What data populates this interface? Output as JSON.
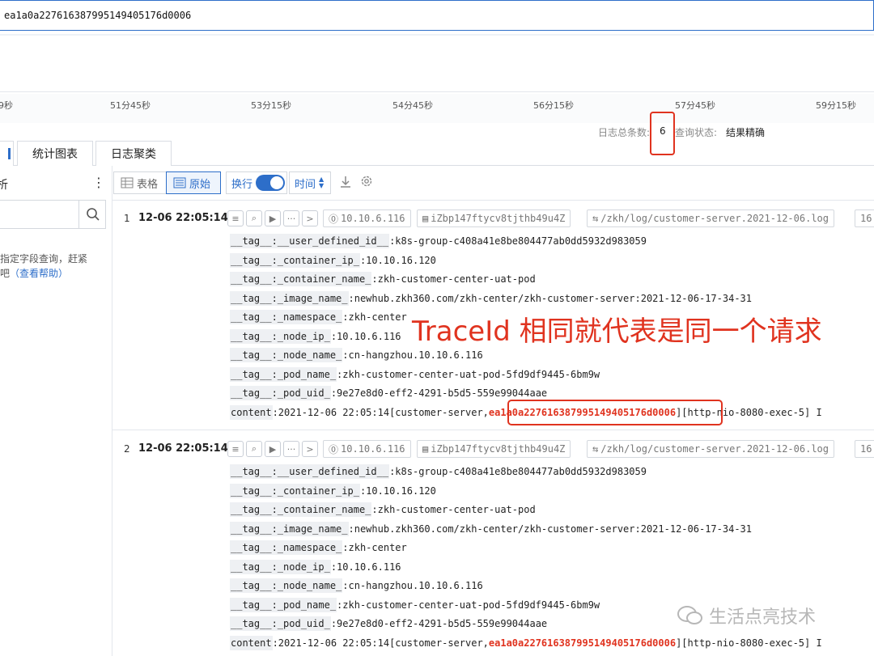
{
  "search": {
    "value": "ea1a0a22761638799514940517­6d0006"
  },
  "timeline": {
    "ticks": [
      "9秒",
      "51分45秒",
      "53分15秒",
      "54分45秒",
      "56分15秒",
      "57分45秒",
      "59分15秒"
    ]
  },
  "summary": {
    "total_label": "日志总条数:",
    "total_value": "6",
    "status_label": "查询状态:",
    "status_value": "结果精确"
  },
  "tabs": {
    "first": " ",
    "stats": "统计图表",
    "cluster": "日志聚类"
  },
  "sidebar": {
    "header": "析",
    "more": "⋮",
    "tip_line1": "指定字段查询，赶紧",
    "tip_line2_prefix": "吧",
    "tip_link": "（查看帮助）"
  },
  "toolbar": {
    "table_label": "表格",
    "raw_label": "原始",
    "wrap_label": "换行",
    "time_label": "时间"
  },
  "records": [
    {
      "index": "1",
      "time": "12-06 22:05:14",
      "ip": "10.10.6.116",
      "host": "iZbp147ftycv8tjthb49u4Z",
      "path": "/zkh/log/customer-server.2021-12-06.log",
      "extra": "16",
      "fields": [
        {
          "key": "__tag__:__user_defined_id__",
          "value": ":k8s-group-c408a41e8be804477ab0dd5932d983059"
        },
        {
          "key": "__tag__:_container_ip_",
          "value": ":10.10.16.120"
        },
        {
          "key": "__tag__:_container_name_",
          "value": ":zkh-customer-center-uat-pod"
        },
        {
          "key": "__tag__:_image_name_",
          "value": ":newhub.zkh360.com/zkh-center/zkh-customer-server:2021-12-06-17-34-31"
        },
        {
          "key": "__tag__:_namespace_",
          "value": ":zkh-center"
        },
        {
          "key": "__tag__:_node_ip_",
          "value": ":10.10.6.116"
        },
        {
          "key": "__tag__:_node_name_",
          "value": ":cn-hangzhou.10.10.6.116"
        },
        {
          "key": "__tag__:_pod_name_",
          "value": ":zkh-customer-center-uat-pod-5fd9df9445-6bm9w"
        },
        {
          "key": "__tag__:_pod_uid_",
          "value": ":9e27e8d0-eff2-4291-b5d5-559e99044aae"
        }
      ],
      "content_key": "content",
      "content_prefix": ":2021-12-06 22:05:14[customer-server, ",
      "content_trace": "ea1a0a22761638799514940517­6d0006",
      "content_suffix": " ][http-nio-8080-exec-5] I"
    },
    {
      "index": "2",
      "time": "12-06 22:05:14",
      "ip": "10.10.6.116",
      "host": "iZbp147ftycv8tjthb49u4Z",
      "path": "/zkh/log/customer-server.2021-12-06.log",
      "extra": "16",
      "fields": [
        {
          "key": "__tag__:__user_defined_id__",
          "value": ":k8s-group-c408a41e8be804477ab0dd5932d983059"
        },
        {
          "key": "__tag__:_container_ip_",
          "value": ":10.10.16.120"
        },
        {
          "key": "__tag__:_container_name_",
          "value": ":zkh-customer-center-uat-pod"
        },
        {
          "key": "__tag__:_image_name_",
          "value": ":newhub.zkh360.com/zkh-center/zkh-customer-server:2021-12-06-17-34-31"
        },
        {
          "key": "__tag__:_namespace_",
          "value": ":zkh-center"
        },
        {
          "key": "__tag__:_node_ip_",
          "value": ":10.10.6.116"
        },
        {
          "key": "__tag__:_node_name_",
          "value": ":cn-hangzhou.10.10.6.116"
        },
        {
          "key": "__tag__:_pod_name_",
          "value": ":zkh-customer-center-uat-pod-5fd9df9445-6bm9w"
        },
        {
          "key": "__tag__:_pod_uid_",
          "value": ":9e27e8d0-eff2-4291-b5d5-559e99044aae"
        }
      ],
      "content_key": "content",
      "content_prefix": ":2021-12-06 22:05:14[customer-server, ",
      "content_trace": "ea1a0a22761638799514940517­6d0006",
      "content_suffix": " ][http-nio-8080-exec-5] I"
    }
  ],
  "annotation": "TraceId 相同就代表是同一个请求",
  "watermark": "生活点亮技术",
  "colors": {
    "accent": "#2d6ec9",
    "highlight": "#e0331f"
  }
}
